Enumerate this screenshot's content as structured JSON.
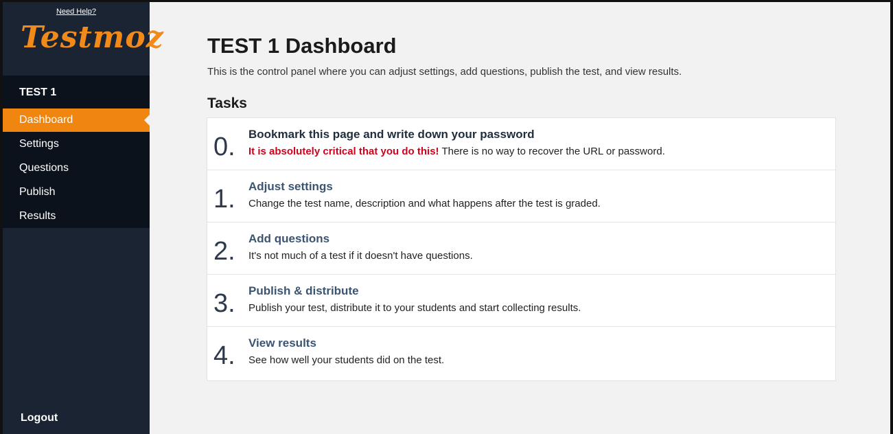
{
  "sidebar": {
    "help_link": "Need Help?",
    "logo": "Testmoz",
    "test_name": "TEST 1",
    "items": [
      {
        "label": "Dashboard",
        "active": true
      },
      {
        "label": "Settings"
      },
      {
        "label": "Questions"
      },
      {
        "label": "Publish"
      },
      {
        "label": "Results"
      }
    ],
    "logout": "Logout"
  },
  "main": {
    "title": "TEST 1 Dashboard",
    "description": "This is the control panel where you can adjust settings, add questions, publish the test, and view results.",
    "tasks_heading": "Tasks",
    "tasks": [
      {
        "num": "0.",
        "title": "Bookmark this page and write down your password",
        "warning": "It is absolutely critical that you do this!",
        "desc": " There is no way to recover the URL or password."
      },
      {
        "num": "1.",
        "title": "Adjust settings",
        "desc": "Change the test name, description and what happens after the test is graded."
      },
      {
        "num": "2.",
        "title": "Add questions",
        "desc": "It's not much of a test if it doesn't have questions."
      },
      {
        "num": "3.",
        "title": "Publish & distribute",
        "desc": "Publish your test, distribute it to your students and start collecting results."
      },
      {
        "num": "4.",
        "title": "View results",
        "desc": "See how well your students did on the test."
      }
    ]
  },
  "colors": {
    "sidebar_bg": "#1b2433",
    "nav_bg": "#0c121b",
    "accent": "#f0850f",
    "warning": "#d0021b",
    "link": "#3b5472"
  }
}
